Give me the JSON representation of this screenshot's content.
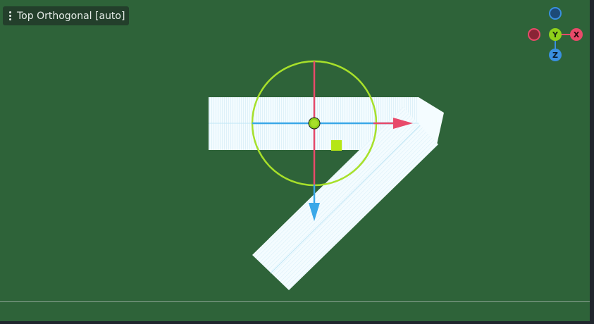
{
  "viewport": {
    "view_label": "Top Orthogonal [auto]",
    "background_color": "#2e6339"
  },
  "nav_gizmo": {
    "y_label": "Y",
    "x_label": "X",
    "z_label": "Z",
    "colors": {
      "x": "#e84a6a",
      "y": "#8fd11a",
      "z": "#3a8fe0"
    }
  },
  "transform_gizmo": {
    "colors": {
      "x_axis": "#e84a6a",
      "z_axis": "#3aa8e8",
      "rotation_ring": "#a7e02a",
      "plane_handle": "#b5e615"
    }
  },
  "mesh": {
    "fill_color": "#f2fbff"
  }
}
